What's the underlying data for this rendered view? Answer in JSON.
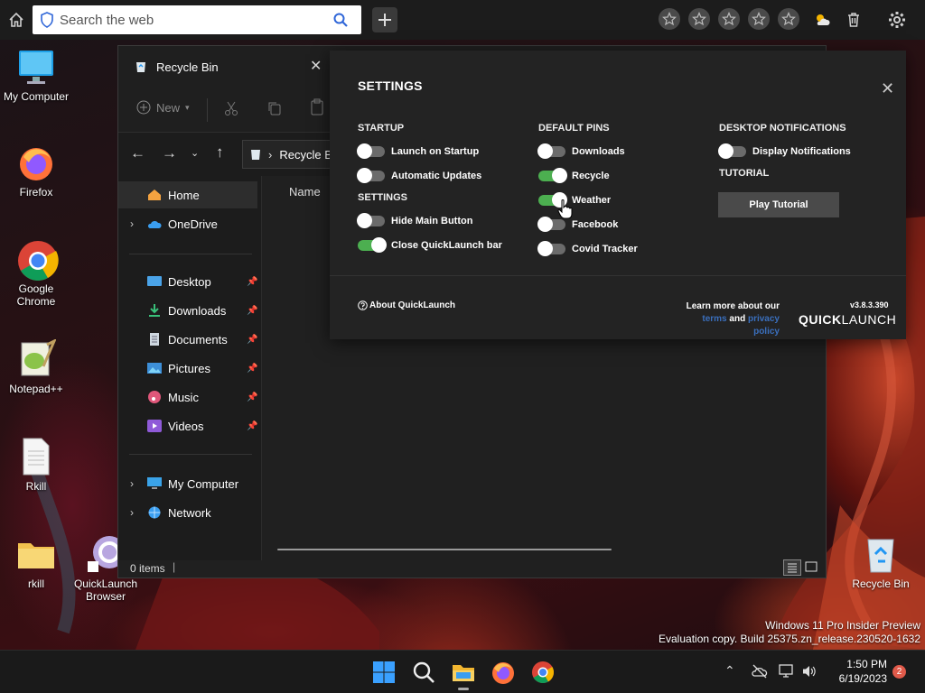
{
  "topbar": {
    "search_placeholder": "Search the web",
    "icons": [
      "home-icon",
      "shield-icon",
      "search-icon",
      "plus-icon",
      "star-icon",
      "weather-icon",
      "trash-icon",
      "gear-icon"
    ]
  },
  "desktop": {
    "icons": [
      {
        "label": "My Computer"
      },
      {
        "label": "Firefox"
      },
      {
        "label": "Google Chrome"
      },
      {
        "label": "Notepad++"
      },
      {
        "label": "Rkill"
      },
      {
        "label": "rkill"
      },
      {
        "label": "QuickLaunch Browser"
      },
      {
        "label": "Recycle Bin"
      }
    ]
  },
  "explorer": {
    "title": "Recycle Bin",
    "toolbar": {
      "new_label": "New"
    },
    "address": "Recycle B",
    "column_name": "Name",
    "nav": {
      "home": "Home",
      "onedrive": "OneDrive",
      "desktop": "Desktop",
      "downloads": "Downloads",
      "documents": "Documents",
      "pictures": "Pictures",
      "music": "Music",
      "videos": "Videos",
      "my_computer": "My Computer",
      "network": "Network"
    },
    "status": "0 items"
  },
  "quicklaunch": {
    "title": "SETTINGS",
    "startup": {
      "heading": "STARTUP",
      "launch": "Launch on Startup",
      "updates": "Automatic Updates"
    },
    "settings": {
      "heading": "SETTINGS",
      "hide": "Hide Main Button",
      "close": "Close QuickLaunch bar"
    },
    "pins": {
      "heading": "DEFAULT PINS",
      "downloads": "Downloads",
      "recycle": "Recycle",
      "weather": "Weather",
      "facebook": "Facebook",
      "covid": "Covid Tracker"
    },
    "notifications": {
      "heading": "DESKTOP NOTIFICATIONS",
      "display": "Display Notifications"
    },
    "tutorial": {
      "heading": "TUTORIAL",
      "button": "Play Tutorial"
    },
    "footer": {
      "about": "About QuickLaunch",
      "learn": "Learn more about our",
      "terms": "terms",
      "and": "and",
      "privacy": "privacy policy",
      "version": "v3.8.3.390",
      "brand_bold": "QUICK",
      "brand_light": "LAUNCH"
    },
    "toggles": {
      "launch_on_startup": false,
      "automatic_updates": false,
      "hide_main_button": false,
      "close_quicklaunch_bar": true,
      "downloads": false,
      "recycle": true,
      "weather": true,
      "facebook": false,
      "covid_tracker": false,
      "display_notifications": false
    },
    "accent_color": "#4caf50"
  },
  "watermark": {
    "line1": "Windows 11 Pro Insider Preview",
    "line2": "Evaluation copy. Build 25375.zn_release.230520-1632"
  },
  "taskbar": {
    "time": "1:50 PM",
    "date": "6/19/2023",
    "notification_count": "2"
  }
}
